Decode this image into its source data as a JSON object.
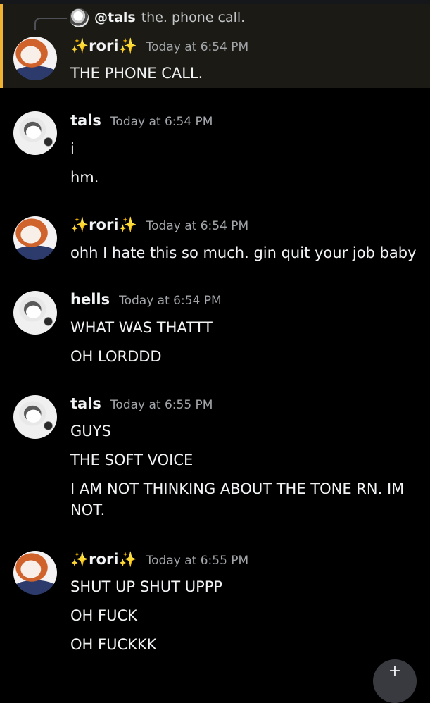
{
  "reply": {
    "author": "@tals",
    "text": "the. phone call."
  },
  "messages": [
    {
      "author": "rori",
      "sparkle_left": "✨",
      "sparkle_right": "✨",
      "timestamp": "Today at 6:54 PM",
      "lines": [
        "THE PHONE CALL."
      ]
    },
    {
      "author": "tals",
      "timestamp": "Today at 6:54 PM",
      "lines": [
        "i",
        "hm."
      ]
    },
    {
      "author": "rori",
      "sparkle_left": "✨",
      "sparkle_right": "✨",
      "timestamp": "Today at 6:54 PM",
      "lines": [
        "ohh I hate this so much. gin quit your job baby"
      ]
    },
    {
      "author": "hells",
      "timestamp": "Today at 6:54 PM",
      "lines": [
        "WHAT WAS THATTT",
        "OH LORDDD"
      ]
    },
    {
      "author": "tals",
      "timestamp": "Today at 6:55 PM",
      "lines": [
        "GUYS",
        "THE SOFT VOICE",
        "I AM NOT THINKING ABOUT THE TONE RN. IM NOT."
      ]
    },
    {
      "author": "rori",
      "sparkle_left": "✨",
      "sparkle_right": "✨",
      "timestamp": "Today at 6:55 PM",
      "lines": [
        "SHUT UP SHUT UPPP",
        "OH FUCK",
        "OH FUCKKK"
      ]
    }
  ],
  "jump_button": {
    "icon": "plus-icon",
    "glyph": "+"
  },
  "colors": {
    "background": "#000000",
    "mention_highlight": "#1b1a14",
    "mention_bar": "#f0b232",
    "timestamp": "#a3a6aa",
    "sparkle": "#f8c43a"
  }
}
